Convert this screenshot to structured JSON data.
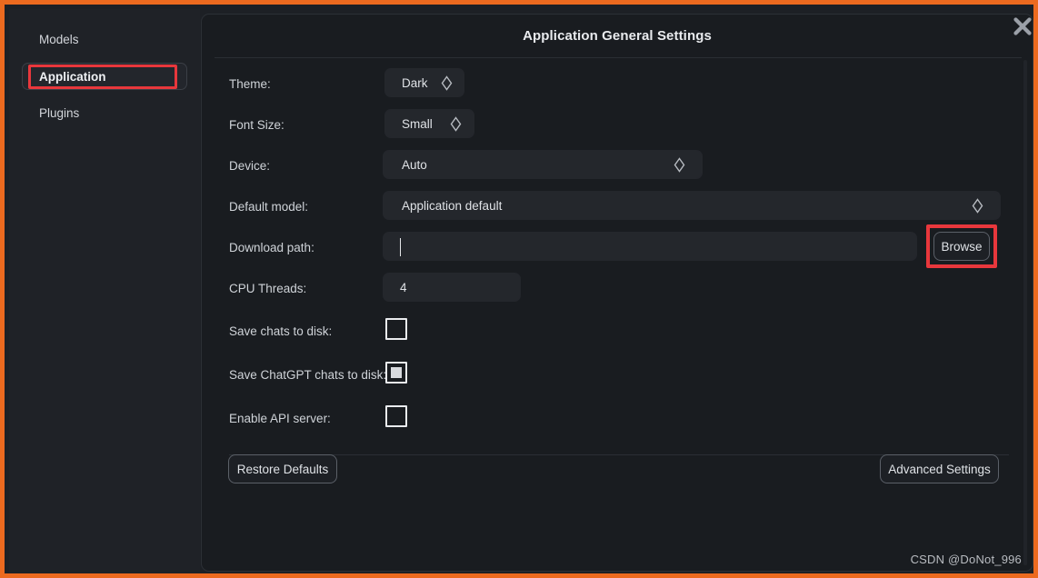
{
  "window": {
    "close_icon": "close-icon"
  },
  "sidebar": {
    "items": [
      {
        "label": "Models",
        "selected": false
      },
      {
        "label": "Application",
        "selected": true
      },
      {
        "label": "Plugins",
        "selected": false
      }
    ]
  },
  "panel": {
    "title": "Application General Settings"
  },
  "form": {
    "rows": [
      {
        "label": "Theme:",
        "value": "Dark",
        "control": "dropdown"
      },
      {
        "label": "Font Size:",
        "value": "Small",
        "control": "dropdown"
      },
      {
        "label": "Device:",
        "value": "Auto",
        "control": "dropdown"
      },
      {
        "label": "Default model:",
        "value": "Application default",
        "control": "dropdown"
      },
      {
        "label": "Download path:",
        "value": "",
        "control": "textfield"
      },
      {
        "label": "CPU Threads:",
        "value": "4",
        "control": "textfield"
      },
      {
        "label": "Save chats to disk:",
        "value": "unchecked",
        "control": "checkbox"
      },
      {
        "label": "Save ChatGPT chats to disk:",
        "value": "checked",
        "control": "checkbox"
      },
      {
        "label": "Enable API server:",
        "value": "unchecked",
        "control": "checkbox"
      }
    ]
  },
  "buttons": {
    "browse": "Browse",
    "restore_defaults": "Restore Defaults",
    "advanced_settings": "Advanced Settings"
  },
  "annotations": {
    "highlight_color": "#e8373c",
    "frame_color": "#ec6a1f"
  },
  "watermark": {
    "text": "CSDN @DoNot_996"
  }
}
